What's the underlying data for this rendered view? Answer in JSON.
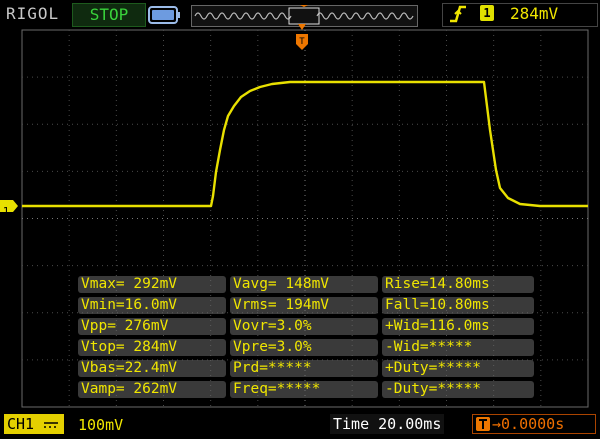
{
  "header": {
    "brand": "RIGOL",
    "run_state": "STOP",
    "trigger_level": "284mV",
    "trigger_source": "1"
  },
  "trigger": {
    "marker_label": "T",
    "channel_marker": "1"
  },
  "measurements": [
    [
      "Vmax= 292mV",
      "Vavg= 148mV",
      "Rise=14.80ms"
    ],
    [
      "Vmin=16.0mV",
      "Vrms= 194mV",
      "Fall=10.80ms"
    ],
    [
      "Vpp= 276mV",
      "Vovr=3.0%",
      "+Wid=116.0ms"
    ],
    [
      "Vtop= 284mV",
      "Vpre=3.0%",
      "-Wid=*****"
    ],
    [
      "Vbas=22.4mV",
      "Prd=*****",
      "+Duty=*****"
    ],
    [
      "Vamp= 262mV",
      "Freq=*****",
      "-Duty=*****"
    ]
  ],
  "footer": {
    "channel": "CH1",
    "channel_scale": "100mV",
    "time_label": "Time 20.00ms",
    "offset": "0.0000s"
  },
  "colors": {
    "trace": "#e8e000",
    "grid": "#4a4a4a",
    "accent_orange": "#ee7700",
    "run_state_green": "#39d23b"
  },
  "icons": [
    "battery-icon",
    "rising-edge-icon",
    "trigger-marker-icon",
    "offset-icon"
  ]
}
